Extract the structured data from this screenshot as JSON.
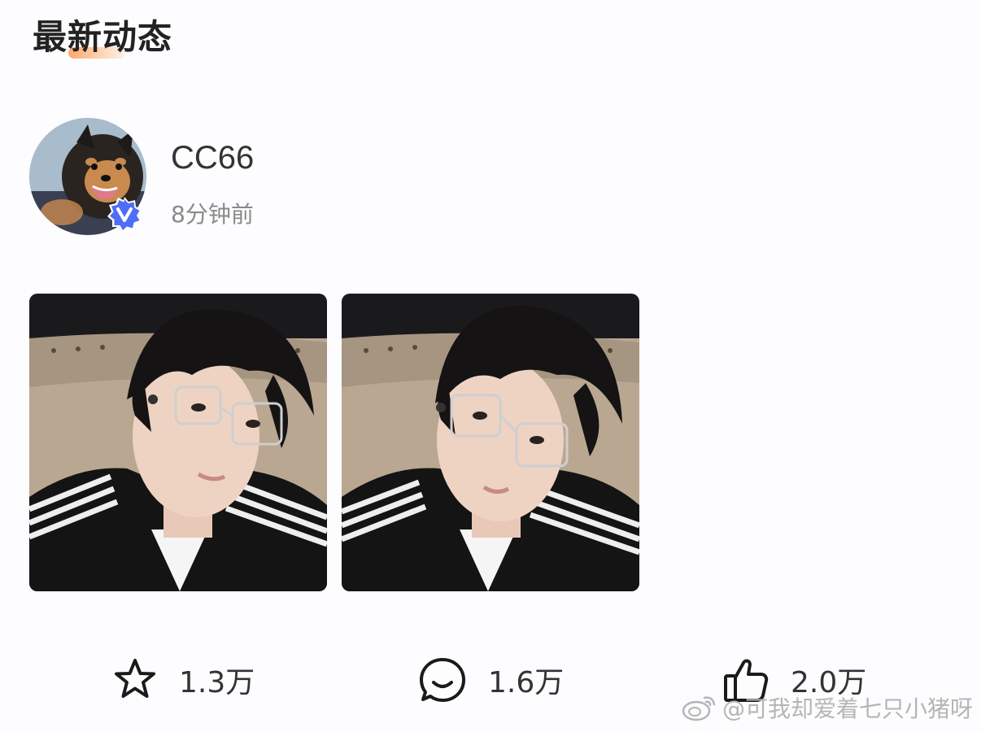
{
  "section": {
    "title": "最新动态"
  },
  "post": {
    "author": "CC66",
    "verified": true,
    "time": "8分钟前",
    "photos": [
      {
        "icon": "selfie-photo"
      },
      {
        "icon": "selfie-photo"
      }
    ]
  },
  "actions": {
    "repost": {
      "icon": "star-icon",
      "count": "1.3万"
    },
    "comment": {
      "icon": "comment-icon",
      "count": "1.6万"
    },
    "like": {
      "icon": "thumbs-up-icon",
      "count": "2.0万"
    }
  },
  "watermark": {
    "text": "@可我却爱着七只小猪呀"
  },
  "colors": {
    "badge": "#4f6ef7",
    "text_primary": "#333333",
    "text_secondary": "#8a8a8a"
  }
}
